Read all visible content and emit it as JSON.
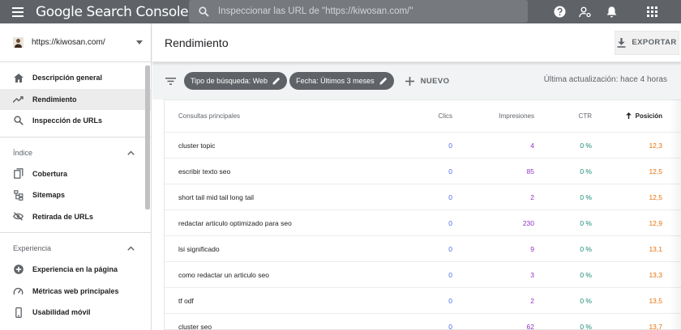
{
  "app": {
    "title": "Google Search Console"
  },
  "search": {
    "placeholder": "Inspeccionar las URL de \"https://kiwosan.com/\""
  },
  "top_icons": [
    "help-icon",
    "manage-accounts-icon",
    "notifications-icon",
    "apps-icon"
  ],
  "property": {
    "url": "https://kiwosan.com/"
  },
  "sidebar": {
    "main_items": [
      {
        "label": "Descripción general",
        "icon": "home-icon"
      },
      {
        "label": "Rendimiento",
        "icon": "trending-up-icon",
        "active": true
      },
      {
        "label": "Inspección de URLs",
        "icon": "search-icon"
      }
    ],
    "sections": [
      {
        "title": "Índice",
        "items": [
          {
            "label": "Cobertura",
            "icon": "copy-icon"
          },
          {
            "label": "Sitemaps",
            "icon": "sitemap-icon"
          },
          {
            "label": "Retirada de URLs",
            "icon": "visibility-off-icon"
          }
        ]
      },
      {
        "title": "Experiencia",
        "items": [
          {
            "label": "Experiencia en la página",
            "icon": "add-circle-icon"
          },
          {
            "label": "Métricas web principales",
            "icon": "speed-icon"
          },
          {
            "label": "Usabilidad móvil",
            "icon": "smartphone-icon"
          }
        ]
      }
    ]
  },
  "main": {
    "title": "Rendimiento",
    "export_label": "EXPORTAR",
    "filters": [
      {
        "label": "Tipo de búsqueda: Web"
      },
      {
        "label": "Fecha: Últimos 3 meses"
      }
    ],
    "new_label": "NUEVO",
    "last_update": "Última actualización: hace 4 horas",
    "table": {
      "headers": {
        "query": "Consultas principales",
        "clicks": "Clics",
        "impressions": "Impresiones",
        "ctr": "CTR",
        "position": "Posición"
      },
      "rows": [
        {
          "query": "cluster topic",
          "clicks": "0",
          "impressions": "4",
          "ctr": "0 %",
          "position": "12,3"
        },
        {
          "query": "escribir texto seo",
          "clicks": "0",
          "impressions": "85",
          "ctr": "0 %",
          "position": "12,5"
        },
        {
          "query": "short tail mid tail long tail",
          "clicks": "0",
          "impressions": "2",
          "ctr": "0 %",
          "position": "12,5"
        },
        {
          "query": "redactar articulo optimizado para seo",
          "clicks": "0",
          "impressions": "230",
          "ctr": "0 %",
          "position": "12,9"
        },
        {
          "query": "lsi significado",
          "clicks": "0",
          "impressions": "9",
          "ctr": "0 %",
          "position": "13,1"
        },
        {
          "query": "como redactar un articulo seo",
          "clicks": "0",
          "impressions": "3",
          "ctr": "0 %",
          "position": "13,3"
        },
        {
          "query": "tf odf",
          "clicks": "0",
          "impressions": "2",
          "ctr": "0 %",
          "position": "13,5"
        },
        {
          "query": "cluster seo",
          "clicks": "0",
          "impressions": "62",
          "ctr": "0 %",
          "position": "13,7"
        }
      ]
    }
  },
  "colors": {
    "topbar": "#5f6368",
    "clicks": "#4e6be0",
    "impressions": "#9334c5",
    "ctr": "#1a8a76",
    "position": "#e8710a"
  }
}
